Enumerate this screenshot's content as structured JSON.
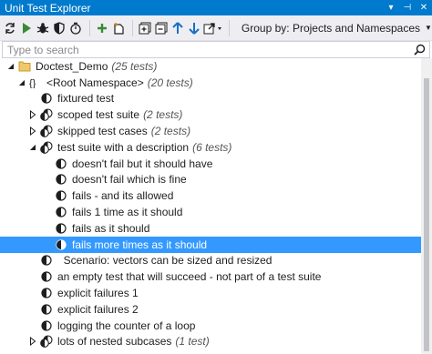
{
  "window": {
    "title": "Unit Test Explorer",
    "dropdown_glyph": "▾",
    "pin_glyph": "⊣",
    "close_glyph": "✕"
  },
  "toolbar": {
    "group_by_label": "Group by: Projects and Namespaces",
    "buttons": [
      "refresh-icon",
      "run-icon",
      "debug-icon",
      "cover-icon",
      "profile-icon",
      "add-test-icon",
      "new-session-icon",
      "expand-all-icon",
      "collapse-all-icon",
      "up-arrow-icon",
      "down-arrow-icon",
      "export-icon"
    ]
  },
  "search": {
    "placeholder": "Type to search"
  },
  "tree": [
    {
      "label": "Doctest_Demo",
      "count": "(25 tests)",
      "icon": "project-folder-icon",
      "expander": "open"
    },
    {
      "label": "<Root Namespace>",
      "count": "(20 tests)",
      "icon": "namespace-icon",
      "expander": "open"
    },
    {
      "label": "fixtured test",
      "count": "",
      "icon": "test-icon",
      "expander": "none"
    },
    {
      "label": "scoped test suite",
      "count": "(2 tests)",
      "icon": "suite-icon",
      "expander": "closed"
    },
    {
      "label": "skipped test cases",
      "count": "(2 tests)",
      "icon": "suite-icon",
      "expander": "closed"
    },
    {
      "label": "test suite with a description",
      "count": "(6 tests)",
      "icon": "suite-icon",
      "expander": "open"
    },
    {
      "label": "doesn't fail but it should have",
      "count": "",
      "icon": "test-icon",
      "expander": "none"
    },
    {
      "label": "doesn't fail which is fine",
      "count": "",
      "icon": "test-icon",
      "expander": "none"
    },
    {
      "label": "fails - and its allowed",
      "count": "",
      "icon": "test-icon",
      "expander": "none"
    },
    {
      "label": "fails 1 time as it should",
      "count": "",
      "icon": "test-icon",
      "expander": "none"
    },
    {
      "label": "fails as it should",
      "count": "",
      "icon": "test-icon",
      "expander": "none"
    },
    {
      "label": "fails more times as it should",
      "count": "",
      "icon": "test-icon",
      "expander": "none",
      "selected": true
    },
    {
      "label": "  Scenario: vectors can be sized and resized",
      "count": "",
      "icon": "test-icon",
      "expander": "none"
    },
    {
      "label": "an empty test that will succeed - not part of a test suite",
      "count": "",
      "icon": "test-icon",
      "expander": "none"
    },
    {
      "label": "explicit failures 1",
      "count": "",
      "icon": "test-icon",
      "expander": "none"
    },
    {
      "label": "explicit failures 2",
      "count": "",
      "icon": "test-icon",
      "expander": "none"
    },
    {
      "label": "logging the counter of a loop",
      "count": "",
      "icon": "test-icon",
      "expander": "none"
    },
    {
      "label": "lots of nested subcases",
      "count": "(1 test)",
      "icon": "suite-icon",
      "expander": "closed"
    }
  ],
  "colors": {
    "title_bar": "#007acc",
    "selection": "#3399ff",
    "toolbar_bg": "#eeeef2"
  }
}
